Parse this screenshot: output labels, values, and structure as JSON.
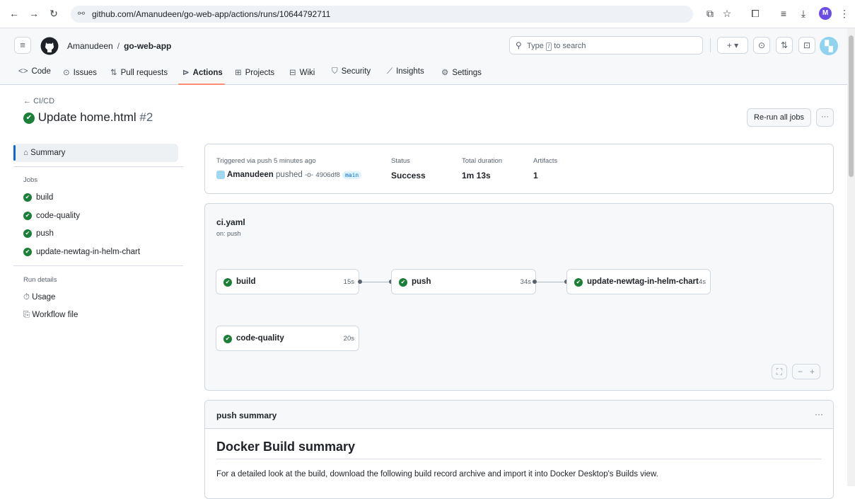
{
  "browser": {
    "url": "github.com/Amanudeen/go-web-app/actions/runs/10644792711",
    "profile_initial": "M"
  },
  "header": {
    "owner": "Amanudeen",
    "separator": "/",
    "repo": "go-web-app",
    "search_prefix": "Type",
    "search_key": "/",
    "search_suffix": "to search",
    "plus": "+ ▾"
  },
  "tabs": [
    {
      "icon": "<>",
      "label": "Code"
    },
    {
      "icon": "⊙",
      "label": "Issues"
    },
    {
      "icon": "⇅",
      "label": "Pull requests"
    },
    {
      "icon": "⊳",
      "label": "Actions"
    },
    {
      "icon": "⊞",
      "label": "Projects"
    },
    {
      "icon": "⊟",
      "label": "Wiki"
    },
    {
      "icon": "⛉",
      "label": "Security"
    },
    {
      "icon": "⟋",
      "label": "Insights"
    },
    {
      "icon": "⚙",
      "label": "Settings"
    }
  ],
  "page": {
    "back_label": "CI/CD",
    "title": "Update home.html",
    "run_number": "#2",
    "rerun_label": "Re-run all jobs",
    "more_label": "···"
  },
  "sidebar": {
    "summary_label": "Summary",
    "jobs_heading": "Jobs",
    "jobs": [
      "build",
      "code-quality",
      "push",
      "update-newtag-in-helm-chart"
    ],
    "run_details_heading": "Run details",
    "usage_label": "Usage",
    "workflow_file_label": "Workflow file"
  },
  "summary": {
    "triggered_label": "Triggered via push 5 minutes ago",
    "actor": "Amanudeen",
    "action": "pushed",
    "commit": "4906df8",
    "branch": "main",
    "status_label": "Status",
    "status_value": "Success",
    "duration_label": "Total duration",
    "duration_value": "1m 13s",
    "artifacts_label": "Artifacts",
    "artifacts_value": "1"
  },
  "workflow": {
    "file": "ci.yaml",
    "trigger": "on: push",
    "jobs": [
      {
        "name": "build",
        "duration": "15s"
      },
      {
        "name": "push",
        "duration": "34s"
      },
      {
        "name": "update-newtag-in-helm-chart",
        "duration": "4s"
      },
      {
        "name": "code-quality",
        "duration": "20s"
      }
    ]
  },
  "push_summary": {
    "heading": "push summary",
    "more": "···",
    "title": "Docker Build summary",
    "para": "For a detailed look at the build, download the following build record archive and import it into Docker Desktop's Builds view."
  },
  "colors": {
    "success": "#1a7f37",
    "accent_underline": "#fd8c73",
    "link": "#0969da"
  }
}
